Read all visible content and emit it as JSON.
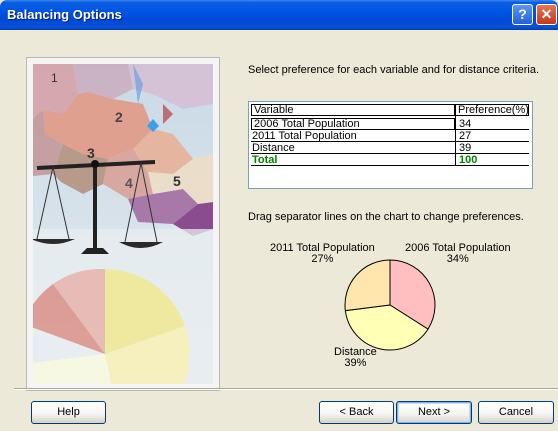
{
  "window": {
    "title": "Balancing Options",
    "help_glyph": "?",
    "close_glyph": "✕"
  },
  "picture": {
    "district_numbers": [
      "1",
      "2",
      "3",
      "4",
      "5"
    ]
  },
  "instructions": "Select preference for each variable and for distance criteria.",
  "table": {
    "headers": {
      "variable": "Variable",
      "preference": "Preference(%)"
    },
    "rows": [
      {
        "variable": "2006 Total Population",
        "preference": "34"
      },
      {
        "variable": "2011 Total Population",
        "preference": "27"
      },
      {
        "variable": "Distance",
        "preference": "39"
      }
    ],
    "total": {
      "variable": "Total",
      "preference": "100"
    }
  },
  "drag_hint": "Drag separator lines on the chart to change preferences.",
  "chart_data": {
    "type": "pie",
    "values": [
      34,
      27,
      39
    ],
    "labels": [
      "2006 Total Population",
      "2011 Total Population",
      "Distance"
    ],
    "percent_labels": [
      "34%",
      "27%",
      "39%"
    ],
    "colors": [
      "#ffbfc0",
      "#ffe6ad",
      "#ffffb5"
    ]
  },
  "buttons": {
    "help": "Help",
    "back": "< Back",
    "next": "Next >",
    "cancel": "Cancel"
  }
}
